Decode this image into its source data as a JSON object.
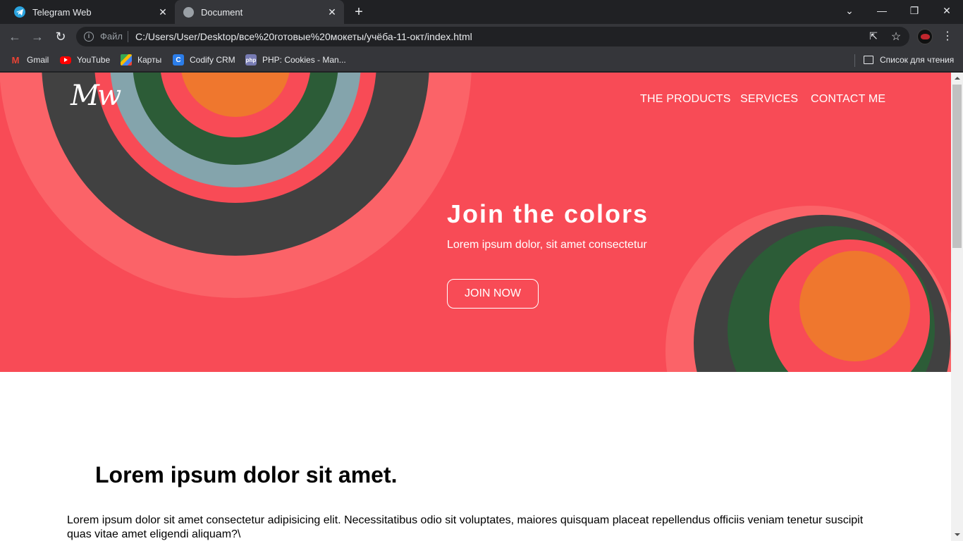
{
  "browser": {
    "tabs": [
      {
        "title": "Telegram Web",
        "icon": "telegram-icon"
      },
      {
        "title": "Document",
        "icon": "globe-icon",
        "active": true
      }
    ],
    "omnibox": {
      "file_label": "Файл",
      "url": "C:/Users/User/Desktop/все%20готовые%20мокеты/учёба-11-окт/index.html"
    },
    "bookmarks": [
      {
        "label": "Gmail",
        "icon": "gmail-icon"
      },
      {
        "label": "YouTube",
        "icon": "youtube-icon"
      },
      {
        "label": "Карты",
        "icon": "maps-icon"
      },
      {
        "label": "Codify CRM",
        "icon": "codify-icon"
      },
      {
        "label": "PHP: Cookies - Man...",
        "icon": "php-icon"
      }
    ],
    "reading_list": "Список для чтения"
  },
  "page": {
    "logo": "Mw",
    "nav": [
      "THE PRODUCTS",
      "SERVICES",
      "CONTACT ME"
    ],
    "hero": {
      "title": "Join the colors",
      "subtitle": "Lorem ipsum dolor, sit amet consectetur",
      "cta": "JOIN NOW"
    },
    "content": {
      "heading": "Lorem ipsum dolor sit amet.",
      "paragraph": "Lorem ipsum dolor sit amet consectetur adipisicing elit. Necessitatibus odio sit voluptates, maiores quisquam placeat repellendus officiis veniam tenetur suscipit quas vitae amet eligendi aliquam?\\"
    }
  },
  "colors": {
    "hero_bg": "#f84b56",
    "ring_light": "#fb6368",
    "ring_dark": "#414141",
    "ring_blue": "#84a4ac",
    "ring_green": "#2c5c37",
    "orange": "#ef772e"
  }
}
